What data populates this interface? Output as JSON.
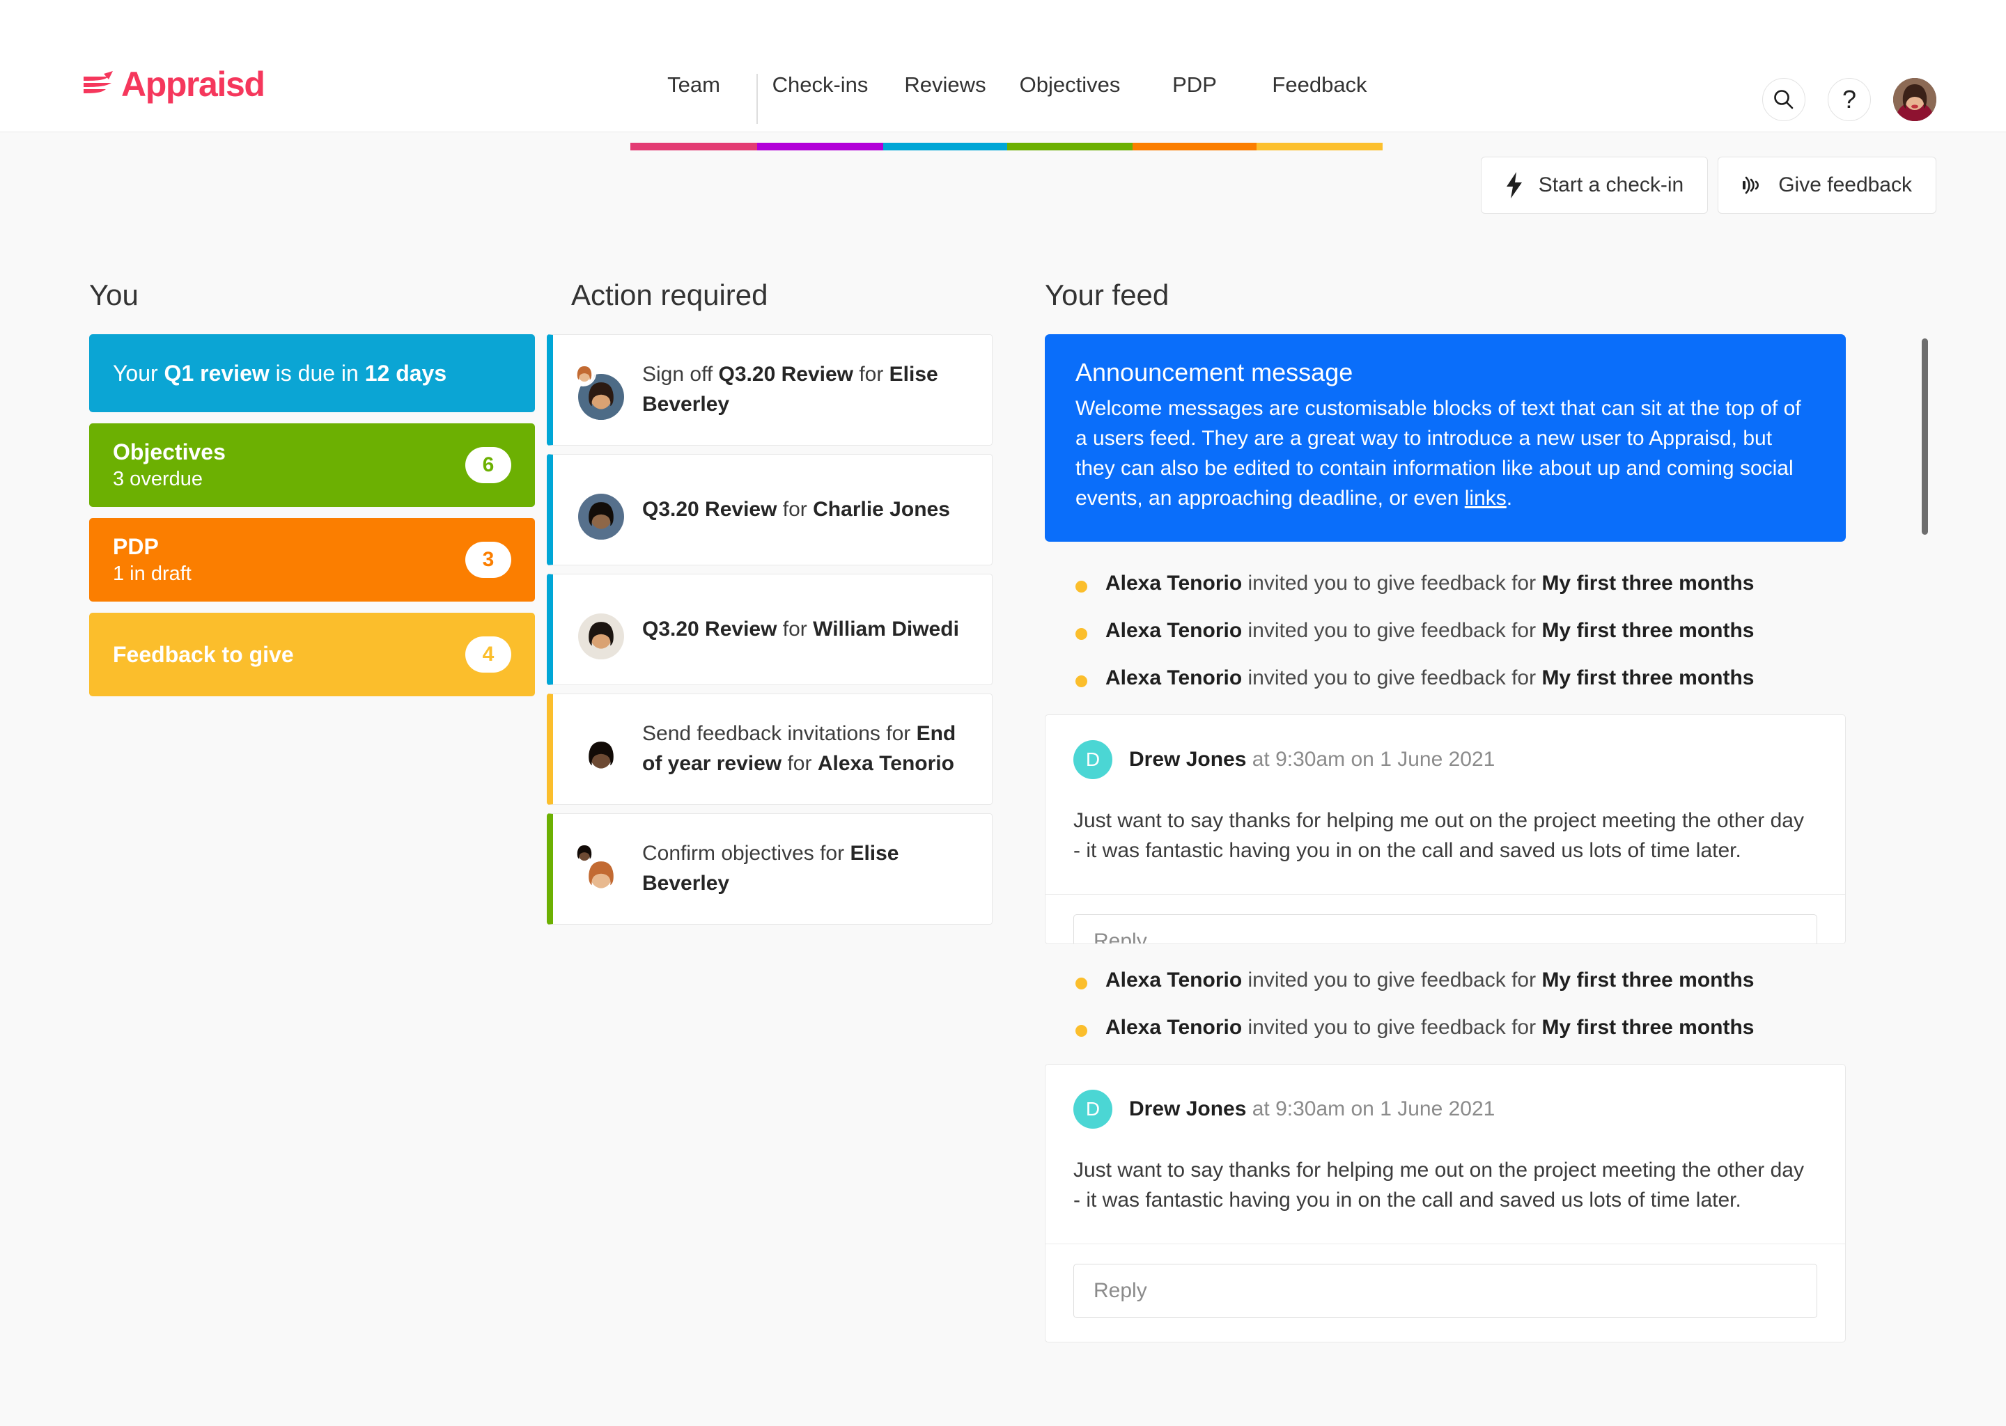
{
  "brand": {
    "name": "Appraisd",
    "color": "#f5375c"
  },
  "nav": {
    "items": [
      {
        "label": "Team",
        "color": "#e33b73"
      },
      {
        "label": "Check-ins",
        "color": "#b200d8"
      },
      {
        "label": "Reviews",
        "color": "#00a6d6"
      },
      {
        "label": "Objectives",
        "color": "#6cb002"
      },
      {
        "label": "PDP",
        "color": "#fb7e00"
      },
      {
        "label": "Feedback",
        "color": "#fcc02e"
      }
    ]
  },
  "header_icons": {
    "search": "search-icon",
    "help": "?",
    "avatar": "user-avatar"
  },
  "toolbar": {
    "start_checkin_label": "Start a check-in",
    "start_checkin_icon": "lightning-bolt-icon",
    "give_feedback_label": "Give feedback",
    "give_feedback_icon": "broadcast-icon"
  },
  "you": {
    "title": "You",
    "review_card": {
      "prefix": "Your ",
      "strong1": "Q1 review",
      "middle": " is due in ",
      "strong2": "12 days",
      "color": "#0ba5d4"
    },
    "cards": [
      {
        "title": "Objectives",
        "subtitle": "3 overdue",
        "badge": "6",
        "color": "#6cb002"
      },
      {
        "title": "PDP",
        "subtitle": "1 in draft",
        "badge": "3",
        "color": "#fb7e00"
      },
      {
        "title": "Feedback to give",
        "subtitle": "",
        "badge": "4",
        "color": "#fbbe2c"
      }
    ]
  },
  "actions": {
    "title": "Action required",
    "items": [
      {
        "prefix": "Sign off ",
        "strong1": "Q3.20 Review",
        "middle": " for ",
        "strong2": "Elise Beverley",
        "suffix": "",
        "accent": "#00a6d6",
        "avatars": 2
      },
      {
        "prefix": "",
        "strong1": "Q3.20 Review",
        "middle": " for ",
        "strong2": "Charlie Jones",
        "suffix": "",
        "accent": "#00a6d6",
        "avatars": 1
      },
      {
        "prefix": "",
        "strong1": "Q3.20 Review",
        "middle": " for ",
        "strong2": "William Diwedi",
        "suffix": "",
        "accent": "#00a6d6",
        "avatars": 1
      },
      {
        "prefix": "Send feedback invitations for ",
        "strong1": "End of year review",
        "middle": " for ",
        "strong2": "Alexa Tenorio",
        "suffix": "",
        "accent": "#fbbe2c",
        "avatars": 1
      },
      {
        "prefix": "Confirm objectives for ",
        "strong1": "Elise Beverley",
        "middle": "",
        "strong2": "",
        "suffix": "",
        "accent": "#6cb002",
        "avatars": 2
      }
    ]
  },
  "feed": {
    "title": "Your feed",
    "announcement": {
      "title": "Announcement message",
      "body_part1": "Welcome messages are customisable blocks of text that can sit at the top of of a users feed. They are a great way to introduce a new user to Appraisd, but they can also be edited to contain information like about up and coming social events, an approaching deadline, or even ",
      "link_text": "links",
      "body_part2": ".",
      "background": "#0a6efa"
    },
    "items_group1": [
      {
        "name": "Alexa Tenorio",
        "middle": " invited you to give feedback for ",
        "topic": "My first three months"
      },
      {
        "name": "Alexa Tenorio",
        "middle": " invited you to give feedback for ",
        "topic": "My first three months"
      },
      {
        "name": "Alexa Tenorio",
        "middle": " invited you to give feedback for ",
        "topic": "My first three months"
      }
    ],
    "comment1": {
      "initial": "D",
      "author": "Drew Jones",
      "timestamp": " at 9:30am on 1 June 2021",
      "body_line1": "Just want to say thanks for helping me out on the project meeting the other day",
      "body_line2": "- it was fantastic having you in on the call and saved us lots of time later.",
      "reply_placeholder": "Reply"
    },
    "items_group2": [
      {
        "name": "Alexa Tenorio",
        "middle": " invited you to give feedback for ",
        "topic": "My first three months"
      },
      {
        "name": "Alexa Tenorio",
        "middle": " invited you to give feedback for ",
        "topic": "My first three months"
      }
    ],
    "comment2": {
      "initial": "D",
      "author": "Drew Jones",
      "timestamp": " at 9:30am on 1 June 2021",
      "body_line1": "Just want to say thanks for helping me out on the project meeting the other day",
      "body_line2": "- it was fantastic having you in on the call and saved us lots of time later.",
      "reply_placeholder": "Reply"
    }
  }
}
